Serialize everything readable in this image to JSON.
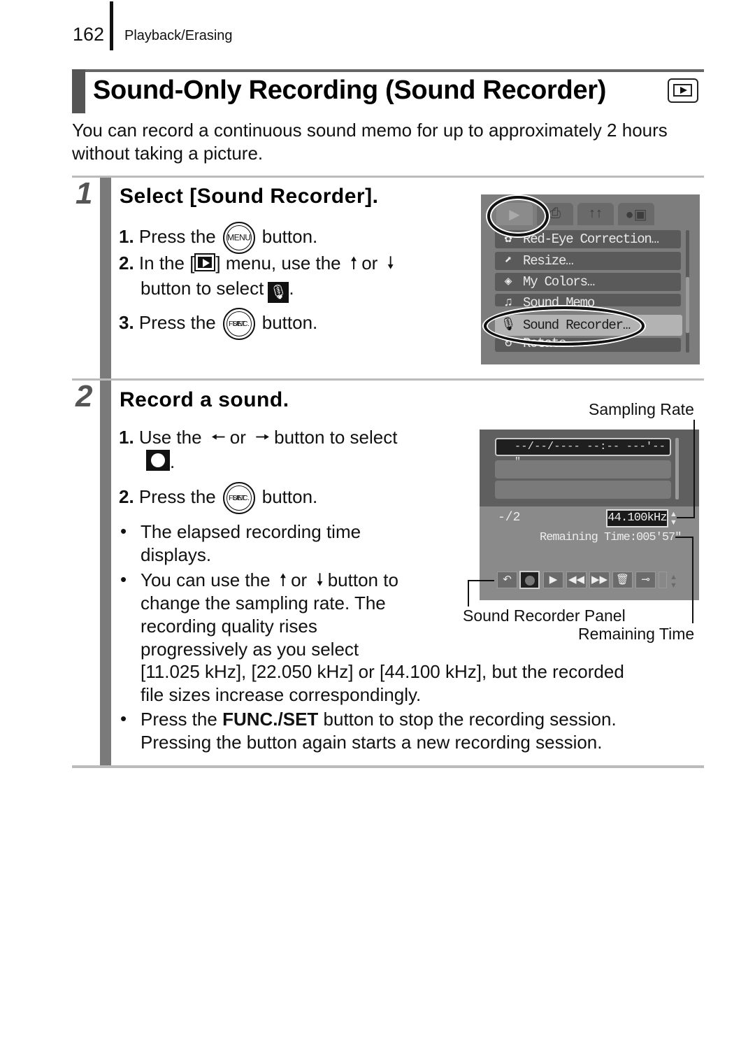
{
  "header": {
    "page_number": "162",
    "section": "Playback/Erasing"
  },
  "title": {
    "text": "Sound-Only Recording (Sound Recorder)",
    "mode_icon": "playback-mode-icon"
  },
  "intro": "You can record a continuous sound memo for up to approximately 2 hours without taking a picture.",
  "steps": [
    {
      "number": "1",
      "title": "Select [Sound Recorder].",
      "instructions": {
        "i1_num": "1.",
        "i1_pre": "Press the",
        "i1_button": "MENU",
        "i1_post": "button.",
        "i2_num": "2.",
        "i2_pre": "In the [",
        "i2_mid": "] menu, use the",
        "i2_or": "or",
        "i2_line2": "button to select",
        "i2_end": ".",
        "i3_num": "3.",
        "i3_pre": "Press the",
        "i3_button_top": "FUNC.",
        "i3_button_bottom": "SET",
        "i3_post": "button."
      },
      "camera_menu": {
        "tabs": [
          "playback-tab",
          "print-tab",
          "setup-tab",
          "my-camera-tab"
        ],
        "items": [
          {
            "label": "Red-Eye Correction…",
            "icon": "red-eye-icon"
          },
          {
            "label": "Resize…",
            "icon": "resize-icon"
          },
          {
            "label": "My Colors…",
            "icon": "my-colors-icon"
          },
          {
            "label": "Sound Memo",
            "icon": "sound-memo-icon"
          },
          {
            "label": "Sound Recorder…",
            "icon": "microphone-icon",
            "selected": true
          },
          {
            "label": "Rotate…",
            "icon": "rotate-icon"
          }
        ]
      }
    },
    {
      "number": "2",
      "title": "Record a sound.",
      "instructions": {
        "i1_num": "1.",
        "i1_pre": "Use the",
        "i1_or": "or",
        "i1_post": "button to select",
        "i1_end": ".",
        "i2_num": "2.",
        "i2_pre": "Press the",
        "i2_button_top": "FUNC.",
        "i2_button_bottom": "SET",
        "i2_post": "button."
      },
      "bullets": {
        "b1_l1": "The elapsed recording time",
        "b1_l2": "displays.",
        "b2_l1_pre": "You can use the",
        "b2_l1_or": "or",
        "b2_l1_post": "button to",
        "b2_l2": "change the sampling rate. The",
        "b2_l3": "recording quality rises",
        "b2_l4": "progressively as you select",
        "b2_l5": "[11.025 kHz], [22.050 kHz] or [44.100 kHz], but the recorded",
        "b2_l6": "file sizes increase correspondingly.",
        "b3_l1_pre": "Press the ",
        "b3_l1_bold": "FUNC./SET",
        "b3_l1_post": " button to stop the recording session.",
        "b3_l2": "Pressing the button again starts a new recording session."
      },
      "recorder_screen": {
        "record_row": "--/--/---- --:--  ---'--\"",
        "file_count": "-/2",
        "sampling_rate": "44.100kHz",
        "remaining_time": "Remaining Time:005'57\"",
        "tools": [
          "back-icon",
          "record-icon",
          "play-icon",
          "rewind-icon",
          "fast-forward-icon",
          "erase-icon",
          "protect-key-icon",
          "volume-icon"
        ]
      },
      "callouts": {
        "sampling_rate": "Sampling Rate",
        "panel": "Sound Recorder Panel",
        "remaining_time": "Remaining Time"
      }
    }
  ]
}
